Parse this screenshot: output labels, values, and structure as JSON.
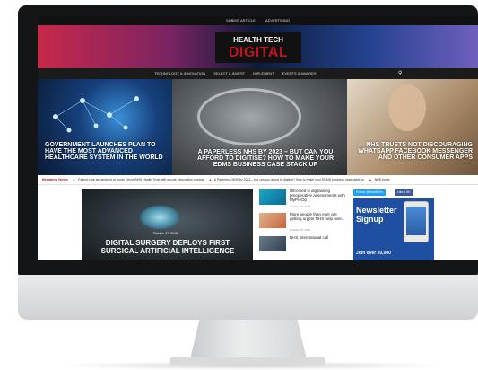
{
  "topbar": {
    "links": [
      "SUBMIT ARTICLE",
      "ADVERTISING"
    ]
  },
  "brand": {
    "line1": "HEALTH TECH",
    "line2": "DIGITAL"
  },
  "nav": {
    "items": [
      "TECHNOLOGY & INNOVATION",
      "SELECT & INVEST",
      "IMPLEMENT",
      "EVENTS & AWARDS"
    ],
    "search_icon": "search-icon"
  },
  "hero": [
    {
      "title": "GOVERNMENT LAUNCHES PLAN TO HAVE THE MOST ADVANCED HEALTHCARE SYSTEM IN THE WORLD"
    },
    {
      "title": "A PAPERLESS NHS BY 2023 – BUT CAN YOU AFFORD TO DIGITISE? HOW TO MAKE YOUR EDMS BUSINESS CASE STACK UP"
    },
    {
      "title": "NHS TRUSTS NOT DISCOURAGING WHATSAPP FACEBOOK MESSENGER AND OTHER CONSUMER APPS"
    }
  ],
  "ticker": {
    "label": "Breaking News",
    "items": [
      "Patient care streamlined at South Devon NHS Health Trust with secure information sharing",
      "A Paperless NHS by 2023 – but can you afford to digitise? How to make your EDMS business case stack up",
      "NHS trusts"
    ]
  },
  "feature": {
    "date": "October 17, 2018",
    "title": "DIGITAL SURGERY DEPLOYS FIRST SURGICAL ARTIFICIAL INTELLIGENCE"
  },
  "side_articles": [
    {
      "title": "Ultromed is digitalising preoperative assessments with MyPreOp",
      "date": "October 15, 2018"
    },
    {
      "title": "More people than ever are getting urgent NHS help over...",
      "date": "October 15, 2018"
    },
    {
      "title": "NHS international call",
      "date": ""
    }
  ],
  "social": {
    "twitter": "Follow @HealthTec",
    "facebook": "Like 1.5K"
  },
  "newsletter": {
    "title": "Newsletter Signup",
    "join": "Join over 20,000"
  },
  "colors": {
    "accent_red": "#c1121f",
    "nav_bg": "#1b1b1b",
    "newsletter_bg": "#1f4fa1"
  }
}
